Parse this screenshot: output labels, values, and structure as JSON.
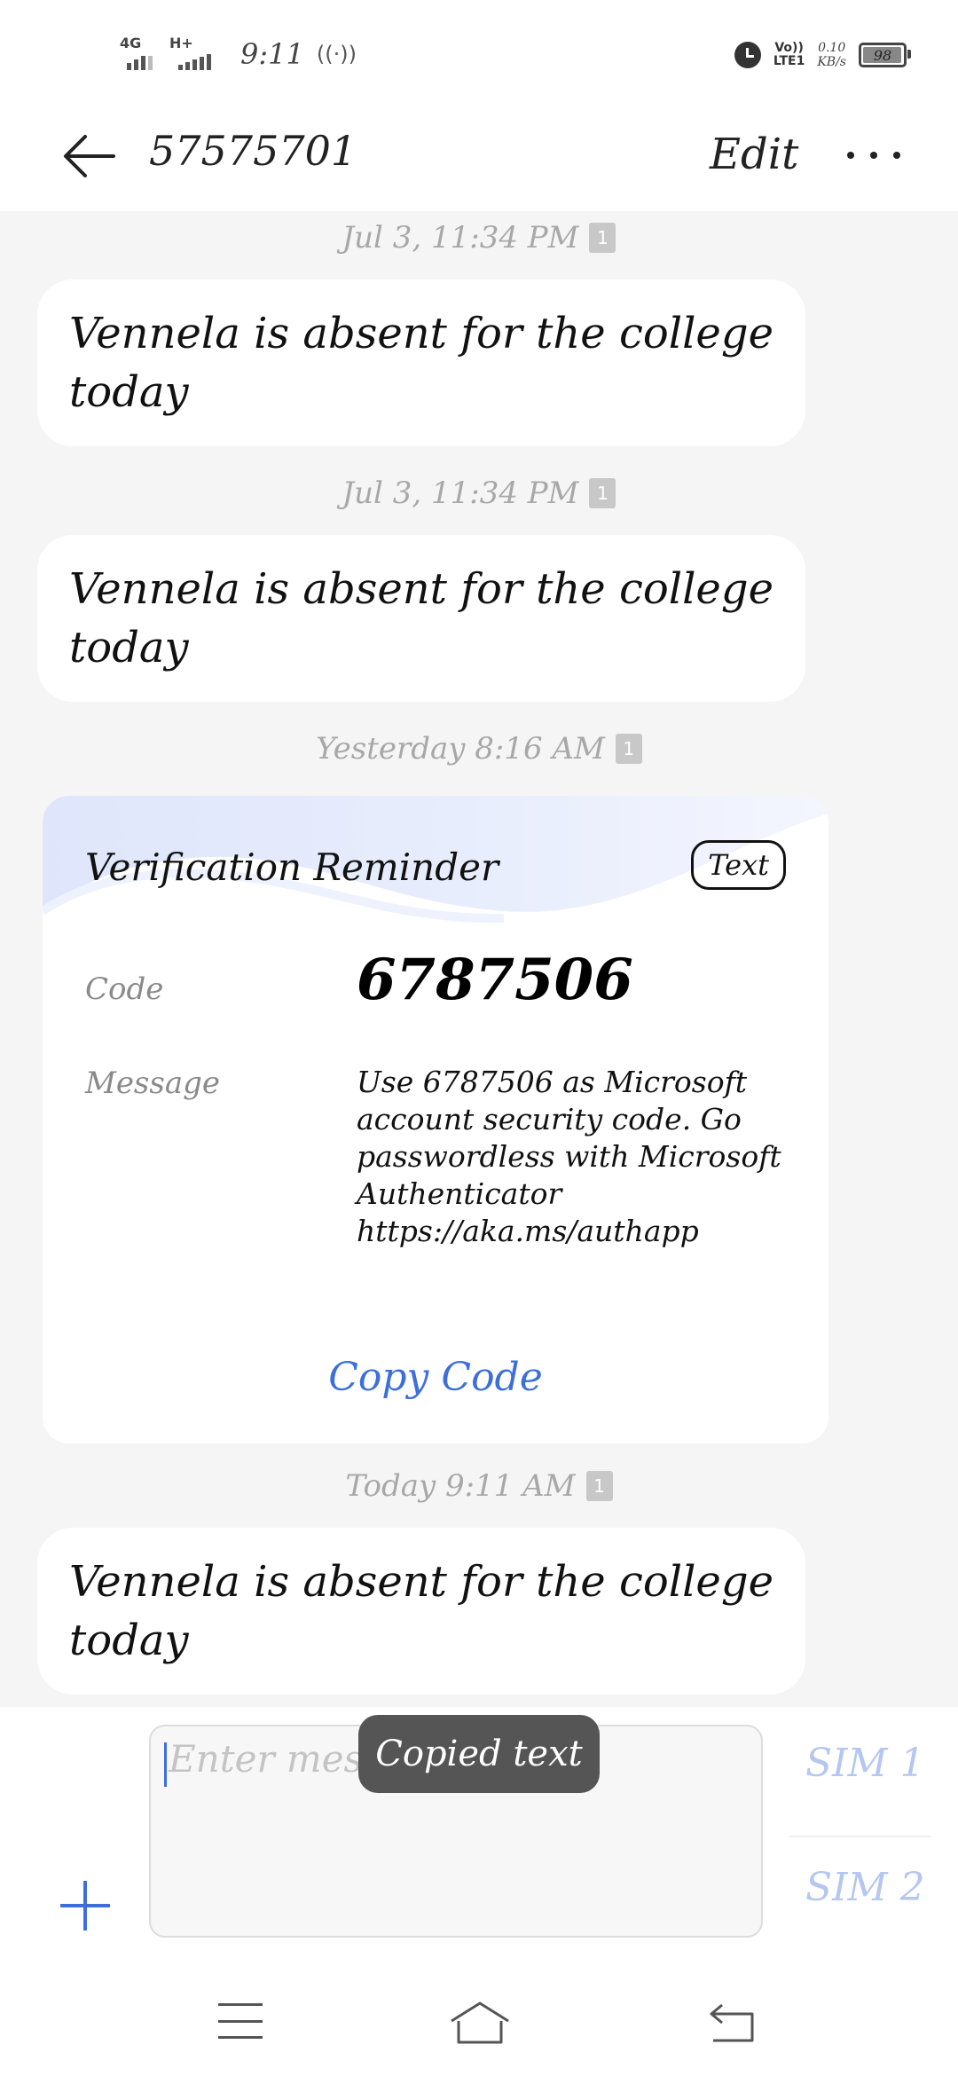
{
  "status_bar": {
    "network_1": "4G",
    "network_2": "H+",
    "time": "9:11",
    "hotspot_glyph": "((·))",
    "volte_line1": "Vo))",
    "volte_line2": "LTE1",
    "speed_value": "0.10",
    "speed_unit": "KB/s",
    "battery_level": "98",
    "battery_fraction": 0.98,
    "icons": [
      "signal-icon",
      "hotspot-icon",
      "alarm-icon",
      "volte-icon",
      "battery-icon"
    ]
  },
  "header": {
    "contact": "57575701",
    "edit_label": "Edit",
    "back_icon": "arrow-left-icon",
    "more_icon": "more-dots-icon"
  },
  "messages": [
    {
      "timestamp": "Jul 3, 11:34 PM",
      "sim": "1",
      "text": "Vennela is absent for the college today"
    },
    {
      "timestamp": "Jul 3, 11:34 PM",
      "sim": "1",
      "text": "Vennela is absent for the college today"
    },
    {
      "timestamp": "Yesterday 8:16 AM",
      "sim": "1"
    },
    {
      "timestamp": "Today 9:11 AM",
      "sim": "1",
      "text": "Vennela is absent for the college today"
    }
  ],
  "verification_card": {
    "title": "Verification Reminder",
    "tag": "Text",
    "code_label": "Code",
    "code": "6787506",
    "message_label": "Message",
    "message": "Use 6787506 as Microsoft account security code. Go passwordless with Microsoft Authenticator https://aka.ms/authapp",
    "copy_button": "Copy Code"
  },
  "composer": {
    "placeholder": "Enter mess",
    "sim1_label": "SIM 1",
    "sim2_label": "SIM 2",
    "add_icon": "plus-icon"
  },
  "toast": "Copied text",
  "colors": {
    "accent": "#3d6fdb",
    "background": "#f5f5f5",
    "bubble": "#ffffff",
    "toast": "#555555",
    "timestamp": "#a8a8a8"
  },
  "nav_icons": [
    "menu-icon",
    "home-icon",
    "back-icon"
  ]
}
